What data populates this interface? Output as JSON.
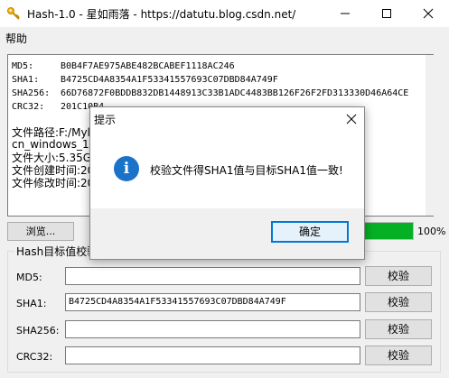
{
  "window": {
    "title": "Hash-1.0 - 星如雨落 - https://datutu.blog.csdn.net/"
  },
  "menu": {
    "help": "帮助"
  },
  "output": {
    "rows": [
      {
        "key": "MD5:",
        "value": "B0B4F7AE975ABE482BCABEF1118AC246"
      },
      {
        "key": "SHA1:",
        "value": "B4725CD4A8354A1F53341557693C07DBD84A749F"
      },
      {
        "key": "SHA256:",
        "value": "66D76872F0BDDB832DB1448913C33B1ADC4483BB126F26F2FD313330D46A64CE"
      },
      {
        "key": "CRC32:",
        "value": "201C10B4"
      }
    ],
    "file_path": "文件路径:F:/Myl",
    "file_name": "cn_windows_10_b",
    "file_size": "文件大小:5.35G",
    "created": "文件创建时间:20",
    "modified": "文件修改时间:20"
  },
  "browse_label": "浏览...",
  "progress": {
    "value": 100,
    "label": "100%"
  },
  "group_title": "Hash目标值校验",
  "verify_fields": [
    {
      "label": "MD5:",
      "value": "",
      "button": "校验"
    },
    {
      "label": "SHA1:",
      "value": "B4725CD4A8354A1F53341557693C07DBD84A749F",
      "button": "校验"
    },
    {
      "label": "SHA256:",
      "value": "",
      "button": "校验"
    },
    {
      "label": "CRC32:",
      "value": "",
      "button": "校验"
    }
  ],
  "dialog": {
    "title": "提示",
    "message": "校验文件得SHA1值与目标SHA1值一致!",
    "ok": "确定",
    "icon": "info-icon"
  },
  "colors": {
    "progress": "#06b025",
    "info_icon": "#1a73c9",
    "ok_border": "#0078d7"
  }
}
